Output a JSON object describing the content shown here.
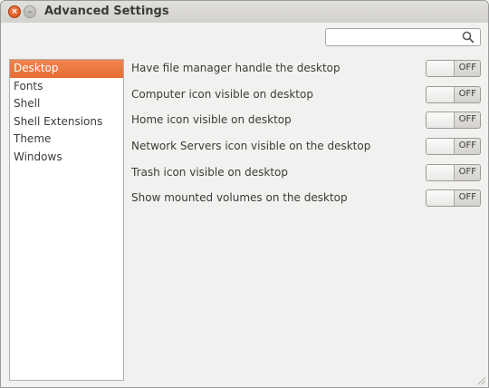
{
  "window": {
    "title": "Advanced Settings",
    "close_glyph": "×",
    "minimize_glyph": "–"
  },
  "search": {
    "value": "",
    "placeholder": "",
    "icon": "search-icon"
  },
  "sidebar": {
    "items": [
      {
        "label": "Desktop",
        "selected": true
      },
      {
        "label": "Fonts",
        "selected": false
      },
      {
        "label": "Shell",
        "selected": false
      },
      {
        "label": "Shell Extensions",
        "selected": false
      },
      {
        "label": "Theme",
        "selected": false
      },
      {
        "label": "Windows",
        "selected": false
      }
    ]
  },
  "settings": [
    {
      "label": "Have file manager handle the desktop",
      "state": "OFF"
    },
    {
      "label": "Computer icon visible on desktop",
      "state": "OFF"
    },
    {
      "label": "Home icon visible on desktop",
      "state": "OFF"
    },
    {
      "label": "Network Servers icon visible on the desktop",
      "state": "OFF"
    },
    {
      "label": "Trash icon visible on desktop",
      "state": "OFF"
    },
    {
      "label": "Show mounted volumes on the desktop",
      "state": "OFF"
    }
  ],
  "colors": {
    "accent": "#e76c33",
    "window_bg": "#f2f1f0",
    "text": "#3c3b37"
  }
}
